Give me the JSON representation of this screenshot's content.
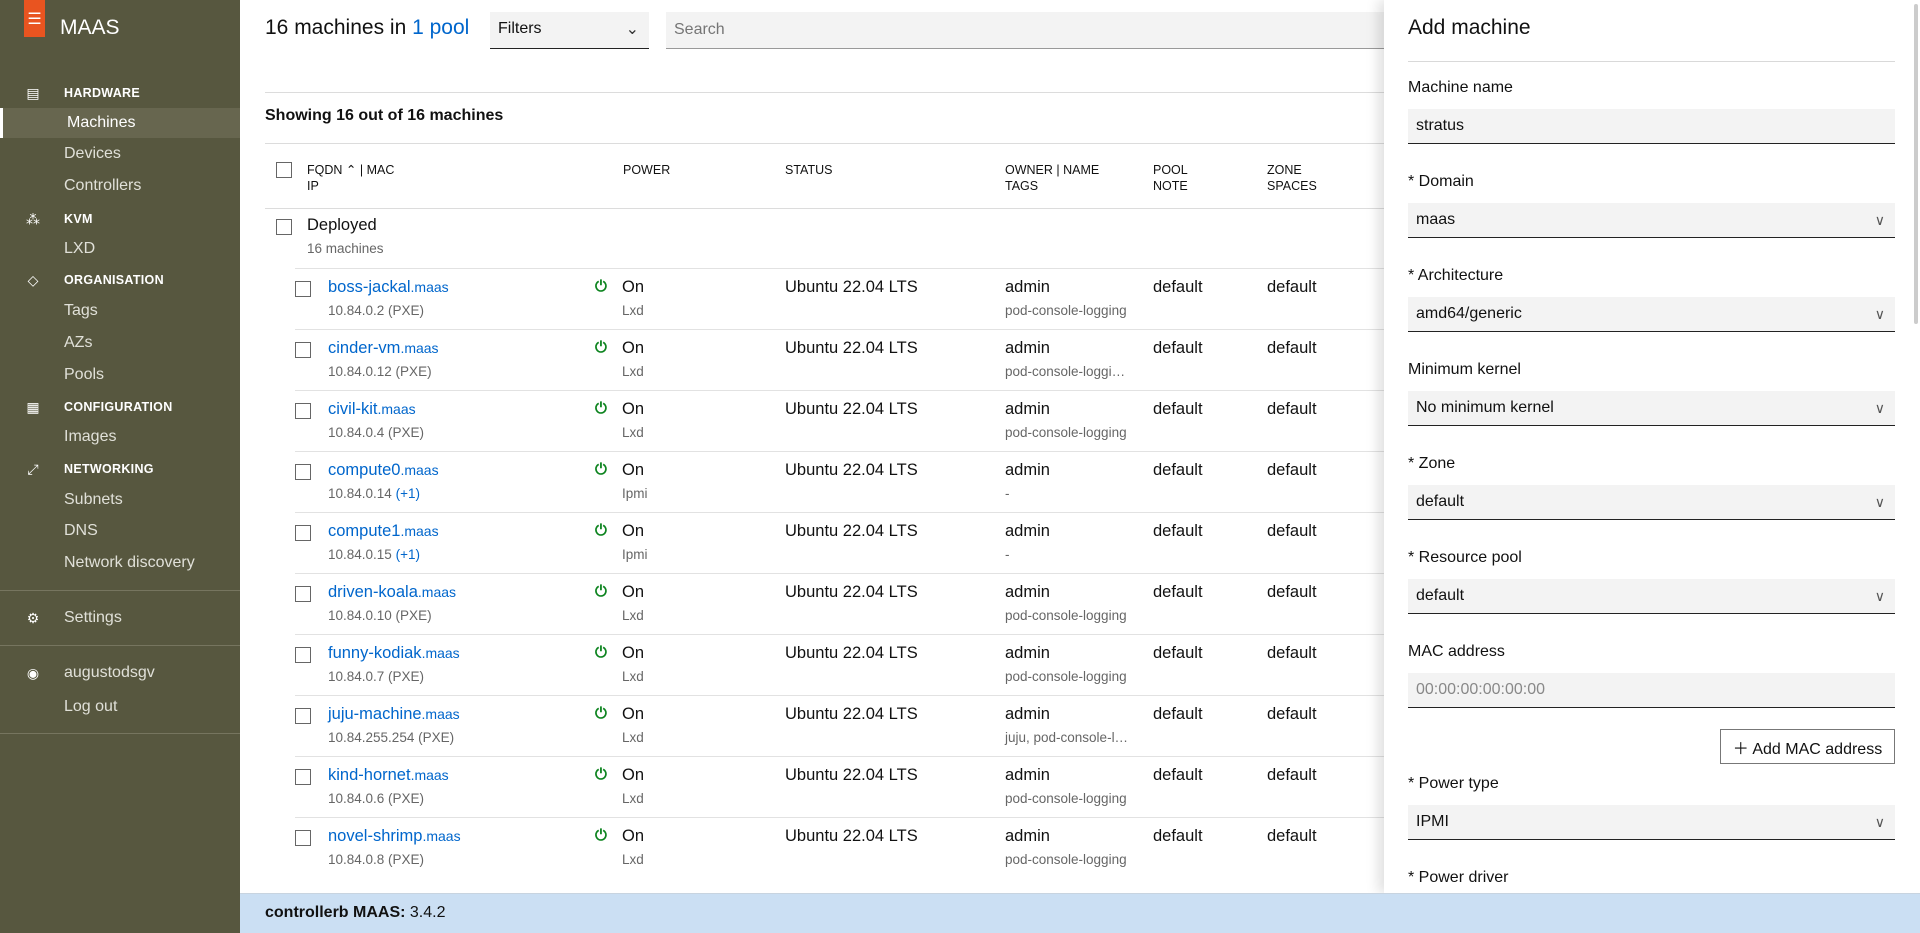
{
  "sidebar": {
    "brand": "MAAS",
    "sections": [
      {
        "label": "HARDWARE",
        "icon": "server-icon"
      },
      {
        "label": "KVM",
        "icon": "cluster-icon"
      },
      {
        "label": "ORGANISATION",
        "icon": "tag-icon"
      },
      {
        "label": "CONFIGURATION",
        "icon": "grid-icon"
      },
      {
        "label": "NETWORKING",
        "icon": "network-icon"
      }
    ],
    "items": {
      "machines": "Machines",
      "devices": "Devices",
      "controllers": "Controllers",
      "lxd": "LXD",
      "tags": "Tags",
      "azs": "AZs",
      "pools": "Pools",
      "images": "Images",
      "subnets": "Subnets",
      "dns": "DNS",
      "discovery": "Network discovery",
      "settings": "Settings",
      "user": "augustodsgv",
      "logout": "Log out"
    }
  },
  "header": {
    "title_prefix": "16 machines in",
    "pool_link": "1 pool",
    "filters": "Filters",
    "search_placeholder": "Search"
  },
  "table": {
    "showing": "Showing 16 out of 16 machines",
    "columns": {
      "fqdn": "FQDN",
      "mac": "| MAC",
      "ip": "IP",
      "power": "POWER",
      "status": "STATUS",
      "owner": "OWNER | NAME",
      "tags": "TAGS",
      "pool": "POOL",
      "note": "NOTE",
      "zone": "ZONE",
      "spaces": "SPACES"
    },
    "group": {
      "label": "Deployed",
      "count": "16 machines"
    },
    "rows": [
      {
        "name": "boss-jackal",
        "domain": ".maas",
        "ip": "10.84.0.2 (PXE)",
        "power": "On",
        "power_type": "Lxd",
        "status": "Ubuntu 22.04 LTS",
        "owner": "admin",
        "tags": "pod-console-logging",
        "pool": "default",
        "zone": "default"
      },
      {
        "name": "cinder-vm",
        "domain": ".maas",
        "ip": "10.84.0.12 (PXE)",
        "power": "On",
        "power_type": "Lxd",
        "status": "Ubuntu 22.04 LTS",
        "owner": "admin",
        "tags": "pod-console-loggi…",
        "pool": "default",
        "zone": "default"
      },
      {
        "name": "civil-kit",
        "domain": ".maas",
        "ip": "10.84.0.4 (PXE)",
        "power": "On",
        "power_type": "Lxd",
        "status": "Ubuntu 22.04 LTS",
        "owner": "admin",
        "tags": "pod-console-logging",
        "pool": "default",
        "zone": "default"
      },
      {
        "name": "compute0",
        "domain": ".maas",
        "ip": "10.84.0.14",
        "ip_extra": "(+1)",
        "power": "On",
        "power_type": "Ipmi",
        "status": "Ubuntu 22.04 LTS",
        "owner": "admin",
        "tags": "-",
        "pool": "default",
        "zone": "default"
      },
      {
        "name": "compute1",
        "domain": ".maas",
        "ip": "10.84.0.15",
        "ip_extra": "(+1)",
        "power": "On",
        "power_type": "Ipmi",
        "status": "Ubuntu 22.04 LTS",
        "owner": "admin",
        "tags": "-",
        "pool": "default",
        "zone": "default"
      },
      {
        "name": "driven-koala",
        "domain": ".maas",
        "ip": "10.84.0.10 (PXE)",
        "power": "On",
        "power_type": "Lxd",
        "status": "Ubuntu 22.04 LTS",
        "owner": "admin",
        "tags": "pod-console-logging",
        "pool": "default",
        "zone": "default"
      },
      {
        "name": "funny-kodiak",
        "domain": ".maas",
        "ip": "10.84.0.7 (PXE)",
        "power": "On",
        "power_type": "Lxd",
        "status": "Ubuntu 22.04 LTS",
        "owner": "admin",
        "tags": "pod-console-logging",
        "pool": "default",
        "zone": "default"
      },
      {
        "name": "juju-machine",
        "domain": ".maas",
        "ip": "10.84.255.254 (PXE)",
        "power": "On",
        "power_type": "Lxd",
        "status": "Ubuntu 22.04 LTS",
        "owner": "admin",
        "tags": "juju, pod-console-l…",
        "pool": "default",
        "zone": "default"
      },
      {
        "name": "kind-hornet",
        "domain": ".maas",
        "ip": "10.84.0.6 (PXE)",
        "power": "On",
        "power_type": "Lxd",
        "status": "Ubuntu 22.04 LTS",
        "owner": "admin",
        "tags": "pod-console-logging",
        "pool": "default",
        "zone": "default"
      },
      {
        "name": "novel-shrimp",
        "domain": ".maas",
        "ip": "10.84.0.8 (PXE)",
        "power": "On",
        "power_type": "Lxd",
        "status": "Ubuntu 22.04 LTS",
        "owner": "admin",
        "tags": "pod-console-logging",
        "pool": "default",
        "zone": "default"
      }
    ]
  },
  "panel": {
    "title": "Add machine",
    "machine_name_label": "Machine name",
    "machine_name": "stratus",
    "domain_label": "* Domain",
    "domain": "maas",
    "arch_label": "* Architecture",
    "arch": "amd64/generic",
    "kernel_label": "Minimum kernel",
    "kernel": "No minimum kernel",
    "zone_label": "* Zone",
    "zone": "default",
    "pool_label": "* Resource pool",
    "pool": "default",
    "mac_label": "MAC address",
    "mac_placeholder": "00:00:00:00:00:00",
    "add_mac": "Add MAC address",
    "power_type_label": "* Power type",
    "power_type": "IPMI",
    "power_driver_label": "* Power driver"
  },
  "footer": {
    "controller": "controllerb",
    "product": "MAAS:",
    "version": "3.4.2"
  },
  "colors": {
    "sidebar": "#57573f",
    "brand": "#e95420",
    "link": "#0066cc",
    "power_on": "#0e8420",
    "footer": "#cbdff3"
  }
}
